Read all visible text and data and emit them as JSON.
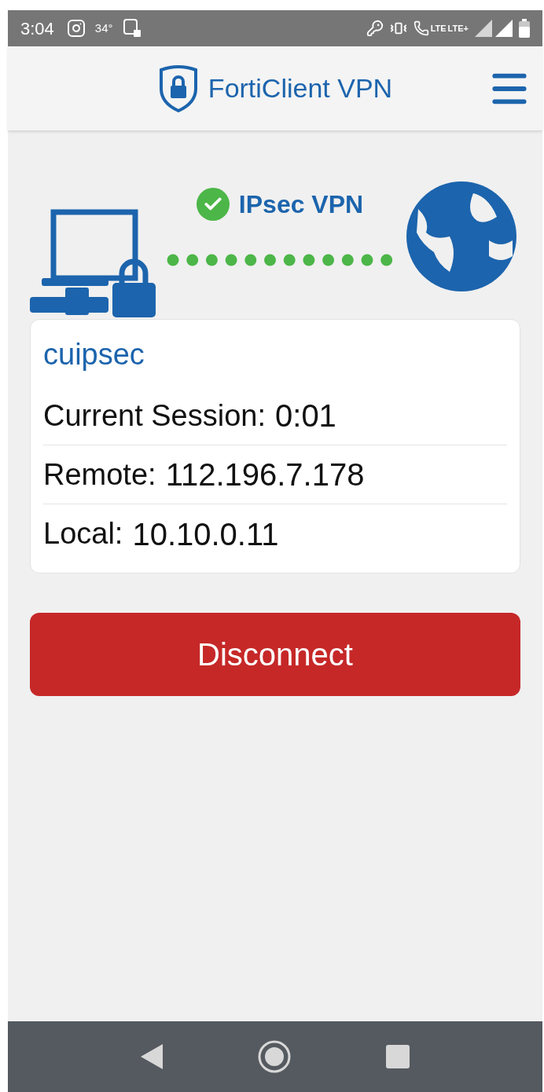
{
  "status_bar": {
    "time": "3:04",
    "temperature": "34°",
    "network_labels": [
      "LTE",
      "LTE+"
    ]
  },
  "header": {
    "title": "FortiClient VPN"
  },
  "connection": {
    "label": "IPsec VPN",
    "connected": true
  },
  "profile": {
    "name": "cuipsec",
    "rows": [
      {
        "label": "Current Session:",
        "value": "0:01"
      },
      {
        "label": "Remote:",
        "value": "112.196.7.178"
      },
      {
        "label": "Local:",
        "value": "10.10.0.11"
      }
    ]
  },
  "action_button": {
    "label": "Disconnect"
  }
}
